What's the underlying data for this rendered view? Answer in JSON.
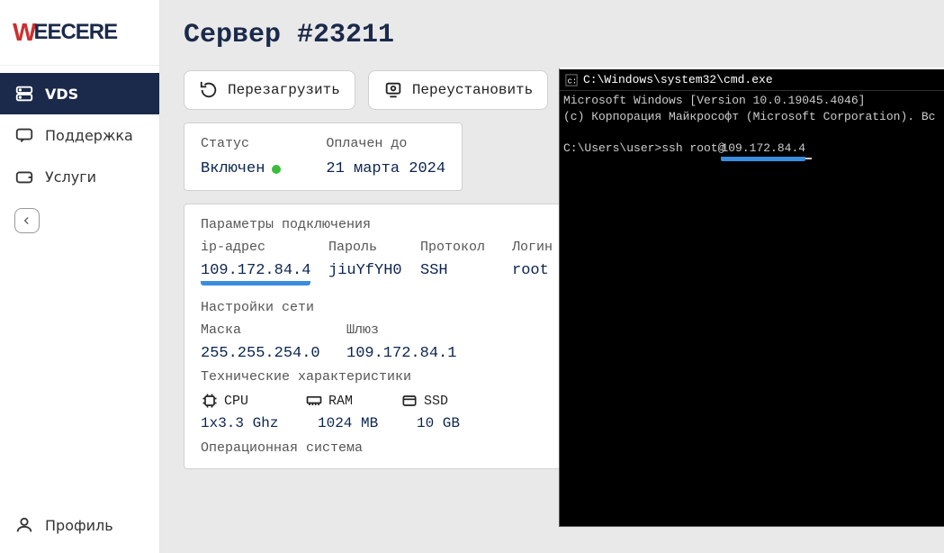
{
  "brand": "WEECERE",
  "sidebar": {
    "items": [
      {
        "label": "VDS"
      },
      {
        "label": "Поддержка"
      },
      {
        "label": "Услуги"
      }
    ],
    "profile": "Профиль"
  },
  "page": {
    "title": "Сервер #23211",
    "buttons": {
      "reboot": "Перезагрузить",
      "reinstall": "Переустановить"
    },
    "status_card": {
      "status_label": "Статус",
      "status_value": "Включен",
      "paid_label": "Оплачен до",
      "paid_value": "21 марта 2024"
    },
    "conn": {
      "title": "Параметры подключения",
      "ip_label": "ip-адрес",
      "ip_value": "109.172.84.4",
      "password_label": "Пароль",
      "password_value": "jiuYfYH0",
      "protocol_label": "Протокол",
      "protocol_value": "SSH",
      "login_label": "Логин",
      "login_value": "root"
    },
    "net": {
      "title": "Настройки сети",
      "mask_label": "Маска",
      "mask_value": "255.255.254.0",
      "gw_label": "Шлюз",
      "gw_value": "109.172.84.1"
    },
    "tech": {
      "title": "Технические характеристики",
      "cpu_label": "CPU",
      "ram_label": "RAM",
      "ssd_label": "SSD",
      "cpu_value": "1x3.3 Ghz",
      "ram_value": "1024 MB",
      "ssd_value": "10 GB"
    },
    "os": {
      "title": "Операционная система"
    }
  },
  "terminal": {
    "title": "C:\\Windows\\system32\\cmd.exe",
    "line1": "Microsoft Windows [Version 10.0.19045.4046]",
    "line2": "(c) Корпорация Майкрософт (Microsoft Corporation). Вс",
    "prompt_prefix": "C:\\Users\\user>ssh root@",
    "prompt_host": "109.172.84.4"
  }
}
